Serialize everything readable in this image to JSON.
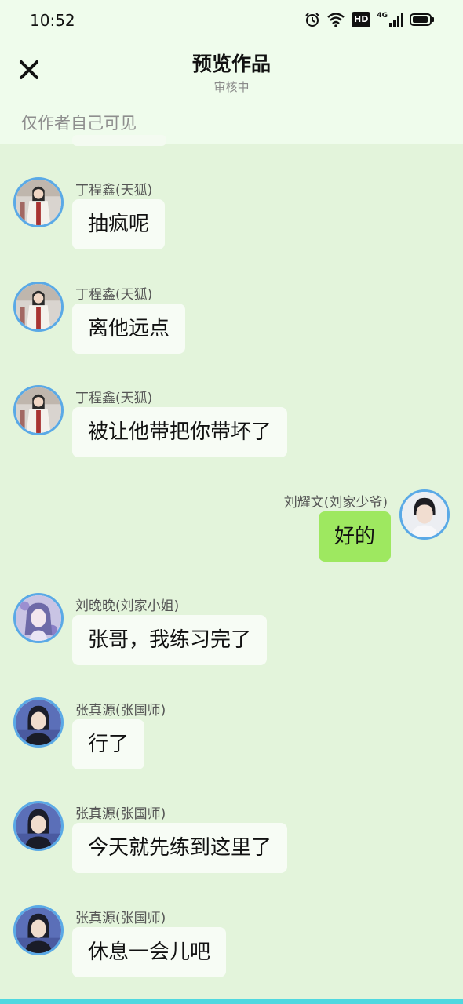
{
  "status": {
    "time": "10:52",
    "icons": [
      "alarm-icon",
      "wifi-icon",
      "hd-icon",
      "4g-signal-icon",
      "battery-icon"
    ],
    "hd_label": "HD",
    "net_label": "4G"
  },
  "header": {
    "title": "预览作品",
    "subtitle": "审核中",
    "visibility_note": "仅作者自己可见",
    "close_icon": "close-icon"
  },
  "colors": {
    "background": "#e3f4db",
    "header_background": "#effcec",
    "bubble_other": "#f7fcf5",
    "bubble_mine": "#9ee860",
    "avatar_ring": "#5aa9e6",
    "bottom_strip": "#4fd8e0"
  },
  "messages": [
    {
      "side": "left",
      "name": "丁程鑫(天狐)",
      "text": "抽疯呢",
      "avatar": "avatar-dingchengxin"
    },
    {
      "side": "left",
      "name": "丁程鑫(天狐)",
      "text": "离他远点",
      "avatar": "avatar-dingchengxin"
    },
    {
      "side": "left",
      "name": "丁程鑫(天狐)",
      "text": "被让他带把你带坏了",
      "avatar": "avatar-dingchengxin"
    },
    {
      "side": "right",
      "name": "刘耀文(刘家少爷)",
      "text": "好的",
      "avatar": "avatar-liuyaowen"
    },
    {
      "side": "left",
      "name": "刘晚晚(刘家小姐)",
      "text": "张哥，我练习完了",
      "avatar": "avatar-liuwanwan"
    },
    {
      "side": "left",
      "name": "张真源(张国师)",
      "text": "行了",
      "avatar": "avatar-zhangzhenyuan"
    },
    {
      "side": "left",
      "name": "张真源(张国师)",
      "text": "今天就先练到这里了",
      "avatar": "avatar-zhangzhenyuan"
    },
    {
      "side": "left",
      "name": "张真源(张国师)",
      "text": "休息一会儿吧",
      "avatar": "avatar-zhangzhenyuan"
    }
  ]
}
